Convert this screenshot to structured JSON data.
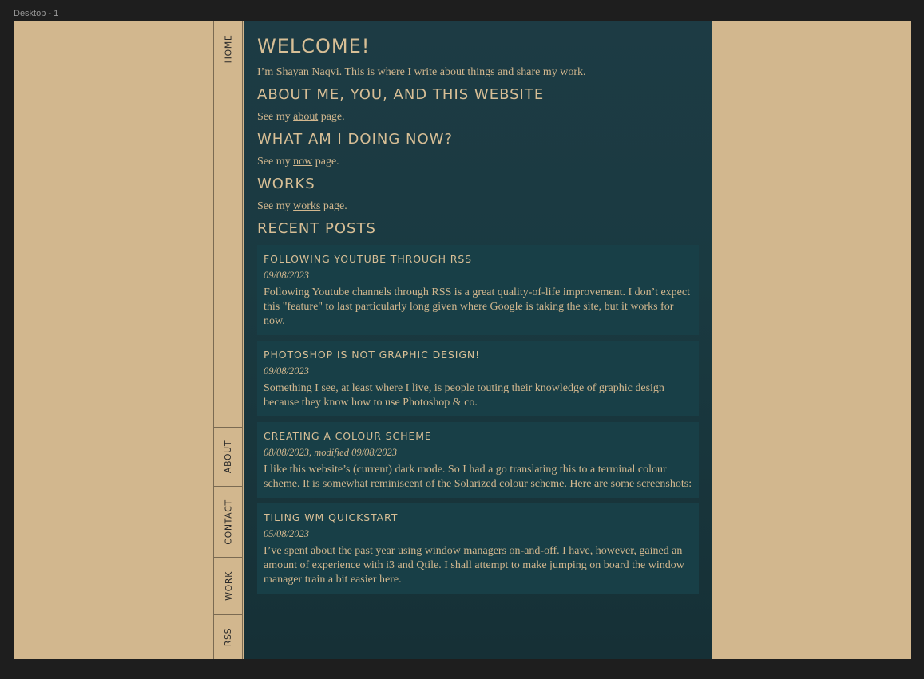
{
  "canvas": {
    "frame_label": "Desktop - 1"
  },
  "nav": {
    "items": [
      {
        "label": "HOME"
      },
      {
        "label": "ABOUT"
      },
      {
        "label": "CONTACT"
      },
      {
        "label": "WORK"
      },
      {
        "label": "RSS"
      }
    ]
  },
  "main": {
    "welcome_title": "WELCOME!",
    "welcome_text": "I’m Shayan Naqvi. This is where I write about things  and share my work.",
    "sections": [
      {
        "title": "ABOUT ME, YOU, AND THIS WEBSITE",
        "prefix": "See my ",
        "link": "about",
        "suffix": " page."
      },
      {
        "title": "WHAT AM I DOING NOW?",
        "prefix": "See my ",
        "link": "now",
        "suffix": " page."
      },
      {
        "title": "WORKS",
        "prefix": "See my ",
        "link": "works",
        "suffix": " page."
      }
    ],
    "recent_title": "RECENT POSTS",
    "posts": [
      {
        "title": "FOLLOWING YOUTUBE THROUGH RSS",
        "date": "09/08/2023",
        "excerpt": "Following Youtube channels through RSS is a great quality-of-life improvement. I don’t expect this \"feature\" to last particularly long given where Google is taking the site, but it works for now."
      },
      {
        "title": "PHOTOSHOP IS NOT GRAPHIC DESIGN!",
        "date": "09/08/2023",
        "excerpt": "Something I see, at least where I live, is people touting their knowledge of graphic design because they know how to use Photoshop & co."
      },
      {
        "title": "CREATING A COLOUR SCHEME",
        "date": "08/08/2023, modified 09/08/2023",
        "excerpt": "I like this website’s (current) dark mode. So I had a go translating this to a terminal colour scheme. It is somewhat reminiscent of the Solarized colour scheme. Here are some screenshots:"
      },
      {
        "title": "TILING WM QUICKSTART",
        "date": "05/08/2023",
        "excerpt": "I’ve spent about the past year using window managers on-and-off. I have, however, gained an amount of experience with i3 and Qtile. I shall attempt to make jumping on board the window manager train a bit easier here."
      }
    ]
  },
  "colors": {
    "background": "#d2b78e",
    "content_bg": "#1d3b44",
    "post_bg": "#183f47",
    "text": "#d2b78e",
    "nav_text": "#2a2a2a"
  }
}
